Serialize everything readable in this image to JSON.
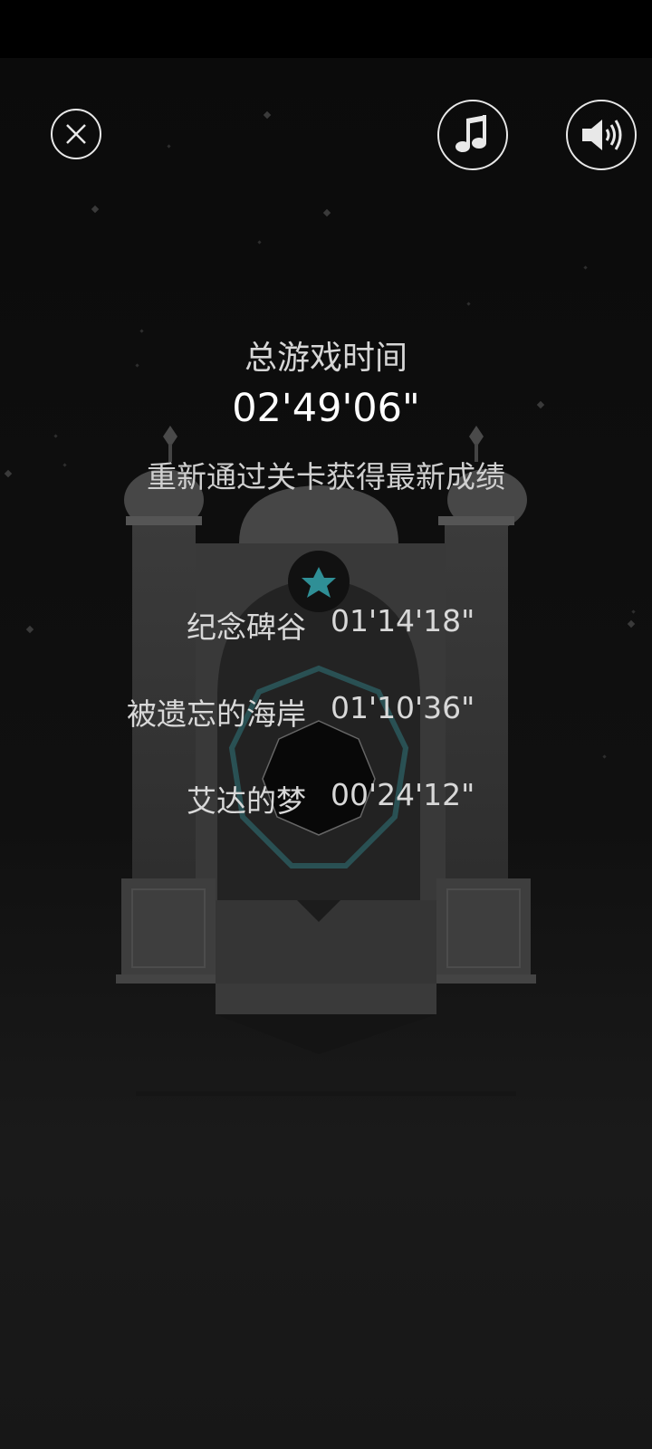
{
  "header": {
    "close_icon": "close-icon",
    "music_icon": "music-note-icon",
    "sound_icon": "speaker-icon"
  },
  "summary": {
    "title": "总游戏时间",
    "total_time": "02'49'06\"",
    "hint": "重新通过关卡获得最新成绩"
  },
  "levels": [
    {
      "name": "纪念碑谷",
      "time": "01'14'18\""
    },
    {
      "name": "被遗忘的海岸",
      "time": "01'10'36\""
    },
    {
      "name": "艾达的梦",
      "time": "00'24'12\""
    }
  ],
  "colors": {
    "background": "#0b0b0b",
    "monument": "#3f3f3f",
    "accent_teal": "#2f8f96",
    "text": "#d8d8d8"
  }
}
